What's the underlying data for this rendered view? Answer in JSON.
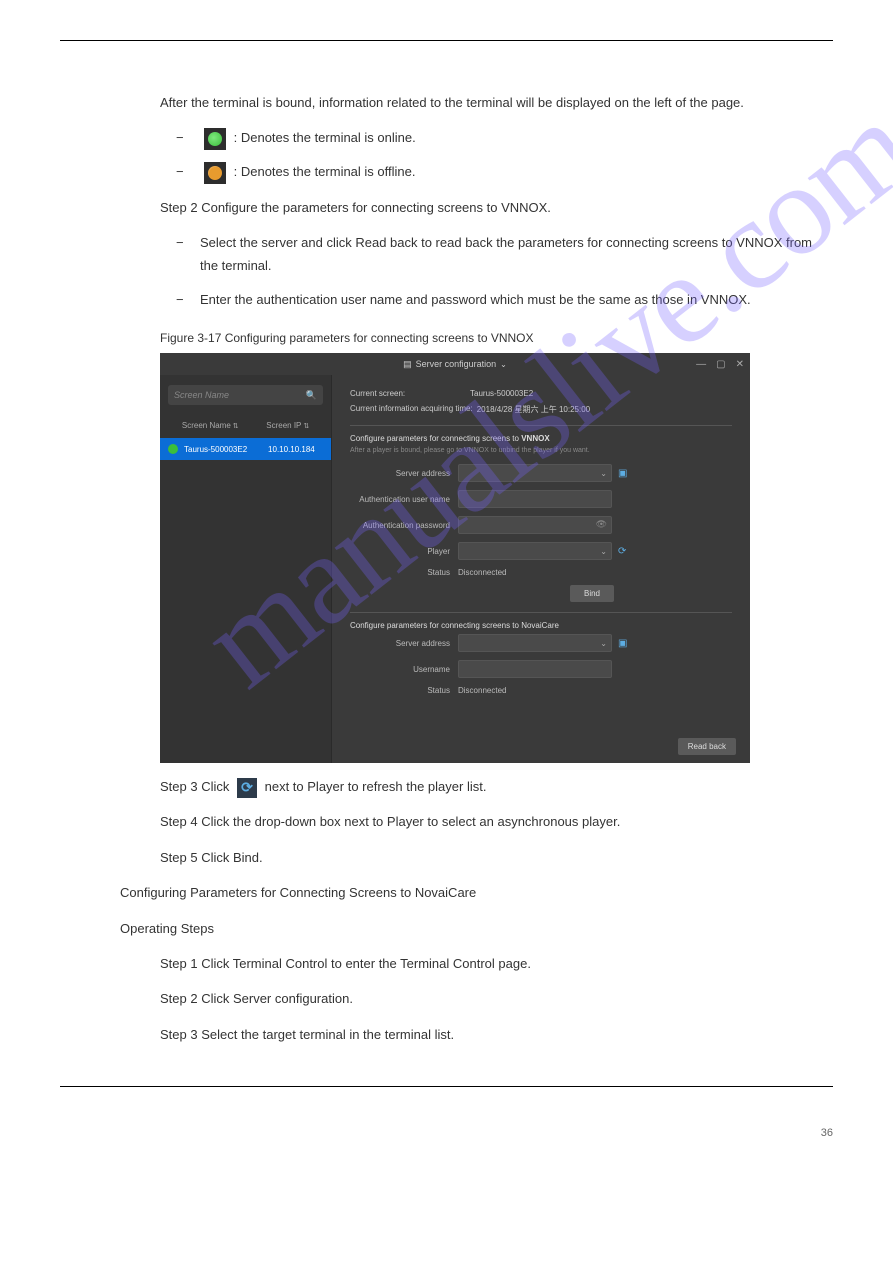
{
  "watermark": "manualslive.com",
  "doc": {
    "intro": "After the terminal is bound, information related to the terminal will be displayed on the left of the page.",
    "dash_green": ": Denotes the terminal is online.",
    "dash_orange": ": Denotes the terminal is offline.",
    "step2_lead": "Step 2 Configure the parameters for connecting screens to VNNOX.",
    "step2_item1": "Select the server and click Read back to read back the parameters for connecting screens to VNNOX from the terminal.",
    "step2_item2": "Enter the authentication user name and password which must be the same as those in VNNOX.",
    "figure_caption": "Figure 3-17 Configuring parameters for connecting screens to VNNOX",
    "step3_lead": "Step 3 Click",
    "step3_tail": "next to Player to refresh the player list.",
    "step4_lead": "Step 4 Click the drop-down box next to Player to select an asynchronous player.",
    "step5_lead": "Step 5 Click Bind.",
    "section_heading": "Configuring Parameters for Connecting Screens to NovaiCare",
    "op_steps_heading": "Operating Steps",
    "bottom_step1": "Step 1 Click Terminal Control to enter the Terminal Control page.",
    "bottom_step2": "Step 2 Click Server configuration.",
    "bottom_step3": "Step 3 Select the target terminal in the terminal list.",
    "page_number": "36"
  },
  "app": {
    "titlebar": {
      "title": "Server configuration"
    },
    "sidebar": {
      "search_placeholder": "Screen Name",
      "col_name": "Screen Name",
      "col_ip": "Screen IP",
      "row": {
        "name": "Taurus-500003E2",
        "ip": "10.10.10.184"
      }
    },
    "main": {
      "current_screen_label": "Current screen:",
      "current_screen_val": "Taurus-500003E2",
      "acq_time_label": "Current information acquiring time:",
      "acq_time_val": "2018/4/28 星期六 上午 10:25:00",
      "vnnox": {
        "section_title_prefix": "Configure parameters for connecting screens to ",
        "section_title_bold": "VNNOX",
        "hint": "After a player is bound, please go to VNNOX to unbind the player if you want.",
        "server_address_label": "Server address",
        "auth_user_label": "Authentication user name",
        "auth_pw_label": "Authentication password",
        "player_label": "Player",
        "status_label": "Status",
        "status_value": "Disconnected",
        "bind_label": "Bind"
      },
      "novaicare": {
        "section_title": "Configure parameters for connecting screens to NovaiCare",
        "server_address_label": "Server address",
        "username_label": "Username",
        "status_label": "Status",
        "status_value": "Disconnected"
      },
      "read_back_label": "Read back"
    }
  }
}
